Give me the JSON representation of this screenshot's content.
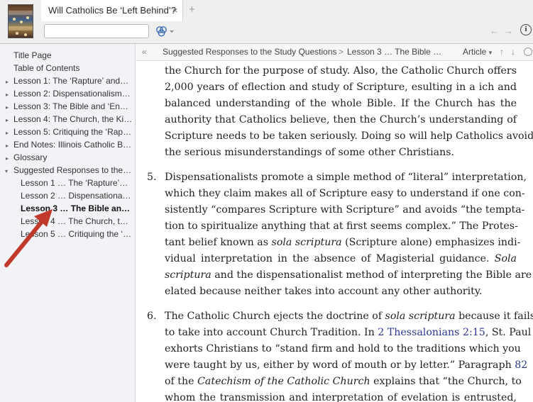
{
  "tab": {
    "title": "Will Catholics Be ‘Left Behind’?",
    "close": "×",
    "add": "+"
  },
  "toolbar": {
    "search_value": "",
    "resources_icon": "resources-icon",
    "back": "←",
    "forward": "→",
    "info": "i"
  },
  "sidebar": {
    "items": [
      {
        "label": "Title Page",
        "level": 0,
        "arrow": ""
      },
      {
        "label": "Table of Contents",
        "level": 0,
        "arrow": ""
      },
      {
        "label": "Lesson 1: The ‘Rapture’ and…",
        "level": 0,
        "arrow": "▸"
      },
      {
        "label": "Lesson 2: Dispensationalism…",
        "level": 0,
        "arrow": "▸"
      },
      {
        "label": "Lesson 3: The Bible and ‘End…",
        "level": 0,
        "arrow": "▸"
      },
      {
        "label": "Lesson 4: The Church, the Ki…",
        "level": 0,
        "arrow": "▸"
      },
      {
        "label": "Lesson 5: Critiquing the ‘Rap…",
        "level": 0,
        "arrow": "▸"
      },
      {
        "label": "End Notes: Illinois Catholic B…",
        "level": 0,
        "arrow": "▸"
      },
      {
        "label": "Glossary",
        "level": 0,
        "arrow": "▸"
      },
      {
        "label": "Suggested Responses to the…",
        "level": 0,
        "arrow": "▾"
      },
      {
        "label": "Lesson 1 … The ‘Rapture’…",
        "level": 1,
        "arrow": ""
      },
      {
        "label": "Lesson 2 … Dispensational…",
        "level": 1,
        "arrow": ""
      },
      {
        "label": "Lesson 3 … The Bible and…",
        "level": 1,
        "arrow": "",
        "selected": true
      },
      {
        "label": "Lesson 4 … The Church, th…",
        "level": 1,
        "arrow": ""
      },
      {
        "label": "Lesson 5 … Critiquing the ‘…",
        "level": 1,
        "arrow": ""
      }
    ]
  },
  "breadcrumb": {
    "collapse": "«",
    "parent": "Suggested Responses to the Study Questions",
    "separator": ">",
    "current": "Lesson 3 … The Bible …",
    "view": "Article",
    "up": "↑",
    "down": "↓"
  },
  "content": {
    "para_top": [
      "the Church for the purpose of study. Also, the Catholic Church offers",
      "2,000 years of eflection and study of Scripture, esulting in a ich and",
      "balanced understanding of the whole Bible. If the Church has the",
      "authority that Catholics believe, then the Church’s understanding of",
      "Scripture needs to be taken seriously. Doing so will help Catholics avoid",
      "the serious misunderstandings of some other Christians."
    ],
    "item5_num": "5.",
    "item5": {
      "l1": "Dispensationalists promote a simple method of “literal” interpretation,",
      "l2": "which they claim makes all of Scripture easy to understand if one con-",
      "l3": "sistently “compares Scripture with Scripture” and avoids “the tempta-",
      "l4": "tion to spiritualize anything that at first seems complex.” The Protes-",
      "l5a": "tant belief known as ",
      "l5b": "sola scriptura",
      "l5c": " (Scripture alone) emphasizes indi-",
      "l6a": "vidual interpretation in the absence of Magisterial guidance. ",
      "l6b": "Sola",
      "l7a": "scriptura",
      "l7b": " and the dispensationalist method of interpreting the Bible are",
      "l8": "elated because neither takes into account any other authority."
    },
    "item6_num": "6.",
    "item6": {
      "l1a": "The Catholic Church ejects the doctrine of ",
      "l1b": "sola scriptura",
      "l1c": " because it fails",
      "l2a": "to take into account Church Tradition. In ",
      "l2link": "2 Thessalonians 2:15",
      "l2c": ", St. Paul",
      "l3": "exhorts Christians to “stand firm and hold to the traditions which you",
      "l4a": "were taught by us, either by word of mouth or by letter.” Paragraph ",
      "l4link": "82",
      "l5a": "of the ",
      "l5b": "Catechism of the Catholic Church",
      "l5c": " explains that “the Church, to",
      "l6": "whom the transmission and interpretation of evelation is entrusted,"
    }
  },
  "annotation": {
    "arrow_color": "#c0392b"
  }
}
